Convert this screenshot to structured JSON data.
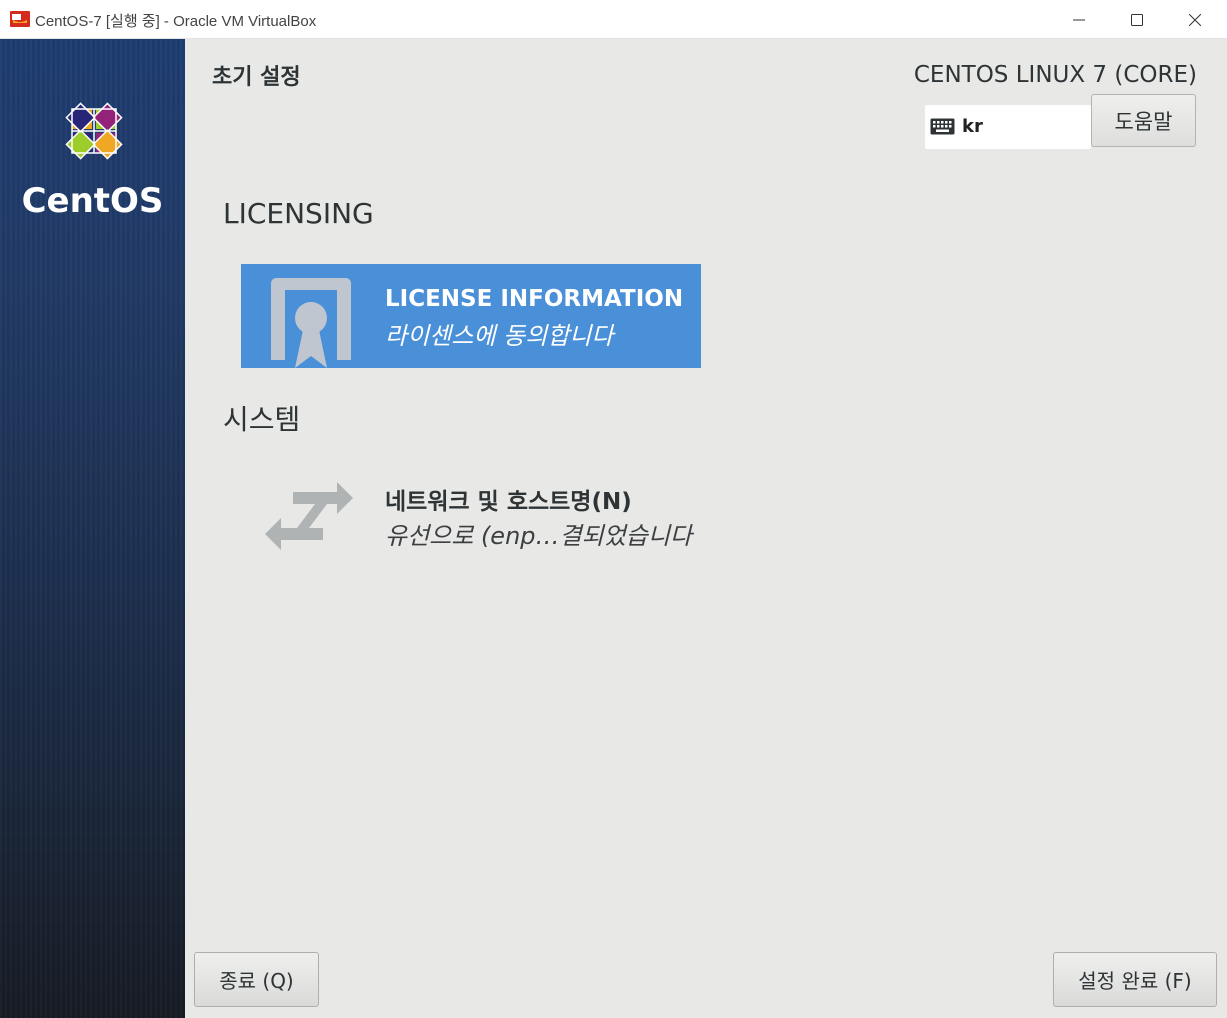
{
  "window": {
    "title": "CentOS-7 [실행 중] - Oracle VM VirtualBox",
    "icon": "virtualbox-icon",
    "controls": [
      "minimize-icon",
      "maximize-icon",
      "close-icon"
    ]
  },
  "sidebar": {
    "logo_text": "CentOS",
    "logo_icon": "centos-logo-icon"
  },
  "header": {
    "title": "초기 설정",
    "product": "CENTOS LINUX 7 (CORE)",
    "keyboard_layout": "kr",
    "keyboard_icon": "keyboard-icon",
    "help_label": "도움말"
  },
  "sections": [
    {
      "heading": "LICENSING",
      "items": [
        {
          "title": "LICENSE INFORMATION",
          "status": "라이센스에 동의합니다",
          "icon": "license-icon",
          "selected": true
        }
      ]
    },
    {
      "heading": "시스템",
      "items": [
        {
          "title": "네트워크 및 호스트명(N)",
          "status": "유선으로 (enp…결되었습니다",
          "icon": "network-arrows-icon",
          "selected": false
        }
      ]
    }
  ],
  "footer": {
    "quit_label": "종료 (Q)",
    "finish_label": "설정 완료 (F)"
  },
  "colors": {
    "accent": "#4a90d9",
    "sidebar_top": "#1f3d72",
    "sidebar_bottom": "#171c24",
    "background": "#e8e8e7"
  }
}
